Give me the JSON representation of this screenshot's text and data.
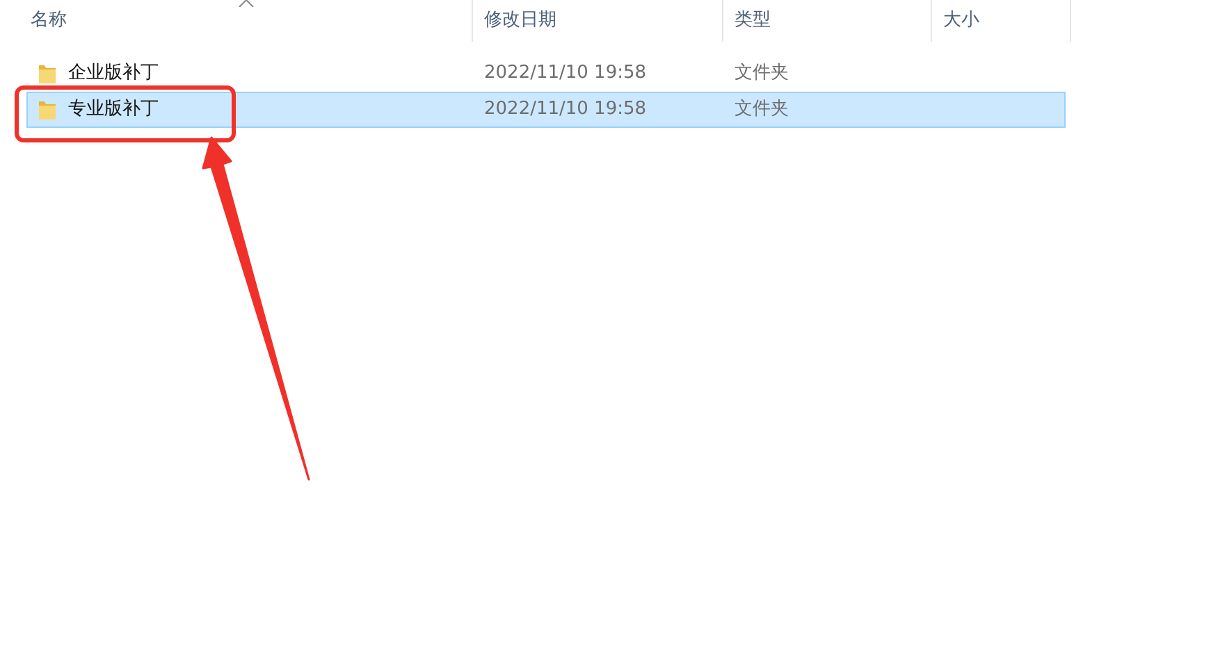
{
  "columns": [
    {
      "label": "名称"
    },
    {
      "label": "修改日期"
    },
    {
      "label": "类型"
    },
    {
      "label": "大小"
    }
  ],
  "rows": [
    {
      "name": "企业版补丁",
      "modified": "2022/11/10 19:58",
      "type": "文件夹",
      "selected": false
    },
    {
      "name": "专业版补丁",
      "modified": "2022/11/10 19:58",
      "type": "文件夹",
      "selected": true
    }
  ]
}
